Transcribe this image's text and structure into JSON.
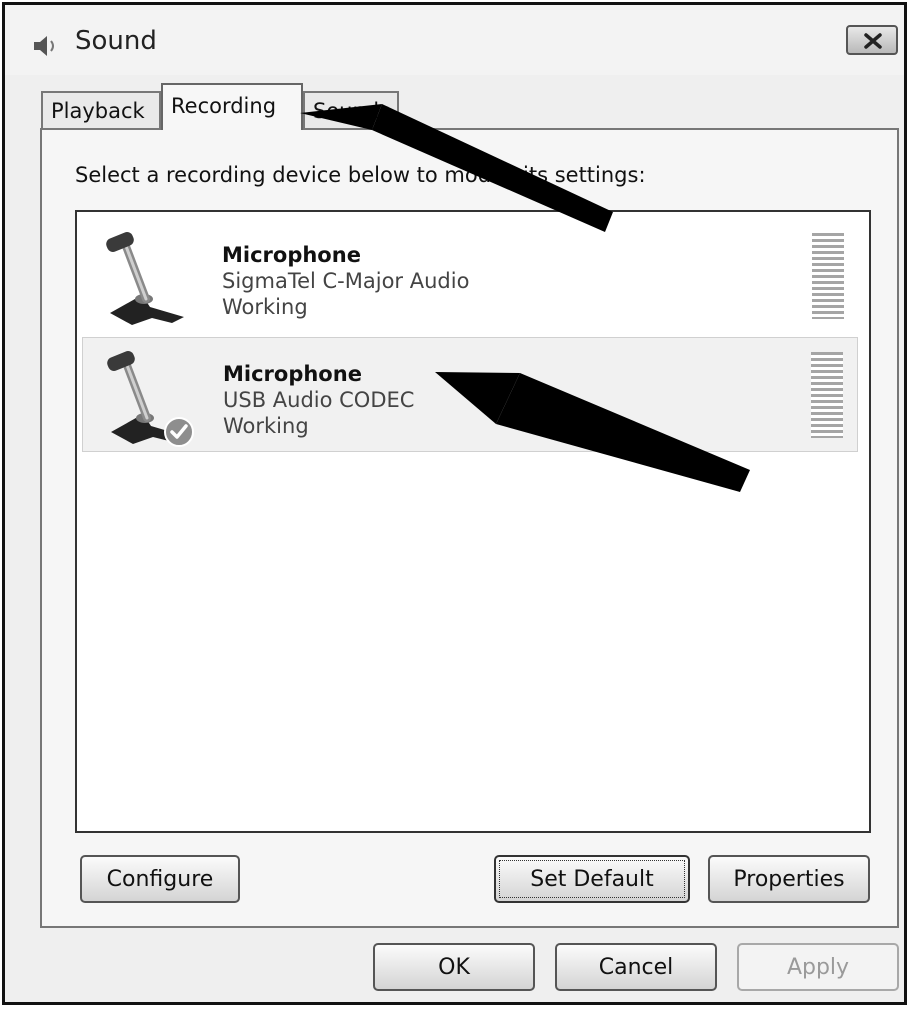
{
  "window": {
    "title": "Sound",
    "icon": "speaker-icon"
  },
  "tabs": [
    {
      "label": "Playback",
      "active": false
    },
    {
      "label": "Recording",
      "active": true
    },
    {
      "label": "Sounds",
      "active": false
    }
  ],
  "recording": {
    "instruction": "Select a recording device below to modify its settings:",
    "devices": [
      {
        "name": "Microphone",
        "driver": "SigmaTel C-Major Audio",
        "status": "Working",
        "icon": "microphone-icon",
        "default": false,
        "selected": false
      },
      {
        "name": "Microphone",
        "driver": "USB Audio CODEC",
        "status": "Working",
        "icon": "microphone-icon",
        "default": true,
        "selected": true
      }
    ],
    "buttons": {
      "configure": "Configure",
      "set_default": "Set Default",
      "properties": "Properties"
    }
  },
  "footer": {
    "ok": "OK",
    "cancel": "Cancel",
    "apply": "Apply",
    "apply_enabled": false
  },
  "annotations": [
    {
      "type": "arrow",
      "points_to": "tab-recording"
    },
    {
      "type": "arrow",
      "points_to": "device-row-usb-audio-codec"
    }
  ]
}
